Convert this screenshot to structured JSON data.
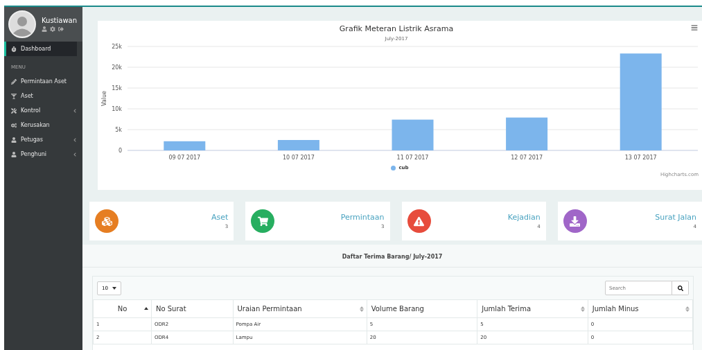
{
  "user": {
    "name": "Kustiawan"
  },
  "sidebar": {
    "items": [
      {
        "label": "Dashboard",
        "selected": true
      },
      {
        "kind": "header",
        "label": "MENU"
      },
      {
        "label": "Permintaan Aset",
        "selected": false
      },
      {
        "label": "Aset",
        "selected": false
      },
      {
        "label": "Kontrol",
        "selected": false,
        "expandable": true
      },
      {
        "label": "Kerusakan",
        "selected": false
      },
      {
        "label": "Petugas",
        "selected": false,
        "expandable": true
      },
      {
        "label": "Penghuni",
        "selected": false,
        "expandable": true
      }
    ]
  },
  "chart": {
    "subtitle": "July-2017",
    "credits": "Highcharts.com",
    "chart_data": {
      "type": "bar",
      "title": "Grafik Meteran Listrik Asrama",
      "ylabel": "Value",
      "grid": true,
      "categories": [
        "09 07 2017",
        "10 07 2017",
        "11 07 2017",
        "12 07 2017",
        "13 07 2017"
      ],
      "series": [
        {
          "name": "cub",
          "color": "#7cb5ec",
          "values": [
            2200,
            2500,
            7400,
            7900,
            23300
          ]
        }
      ],
      "ylim": [
        0,
        25000
      ],
      "yticks": [
        {
          "value": 0,
          "label": "0"
        },
        {
          "value": 5000,
          "label": "5k"
        },
        {
          "value": 10000,
          "label": "10k"
        },
        {
          "value": 15000,
          "label": "15k"
        },
        {
          "value": 20000,
          "label": "20k"
        },
        {
          "value": 25000,
          "label": "25k"
        }
      ]
    }
  },
  "stats": [
    {
      "label": "Aset",
      "count": "3",
      "color": "#e67e22"
    },
    {
      "label": "Permintaan",
      "count": "3",
      "color": "#27ae60"
    },
    {
      "label": "Kejadian",
      "count": "4",
      "color": "#e74c3c"
    },
    {
      "label": "Surat Jalan",
      "count": "4",
      "color": "#a066c8"
    }
  ],
  "table": {
    "title": "Daftar Terima Barang/ July-2017",
    "page_size": "10",
    "search": {
      "placeholder": "Search"
    },
    "columns": [
      {
        "label": "No",
        "sortable": true,
        "sorted": true
      },
      {
        "label": "No Surat",
        "sortable": false
      },
      {
        "label": "Uraian Permintaan",
        "sortable": true,
        "sorted": false
      },
      {
        "label": "Volume Barang",
        "sortable": false
      },
      {
        "label": "Jumlah Terima",
        "sortable": true,
        "sorted": false
      },
      {
        "label": "Jumlah Minus",
        "sortable": true,
        "sorted": false
      }
    ],
    "rows": [
      [
        "1",
        "ODR2",
        "Pompa Air",
        "5",
        "5",
        "0"
      ],
      [
        "2",
        "ODR4",
        "Lampu",
        "20",
        "20",
        "0"
      ]
    ]
  }
}
